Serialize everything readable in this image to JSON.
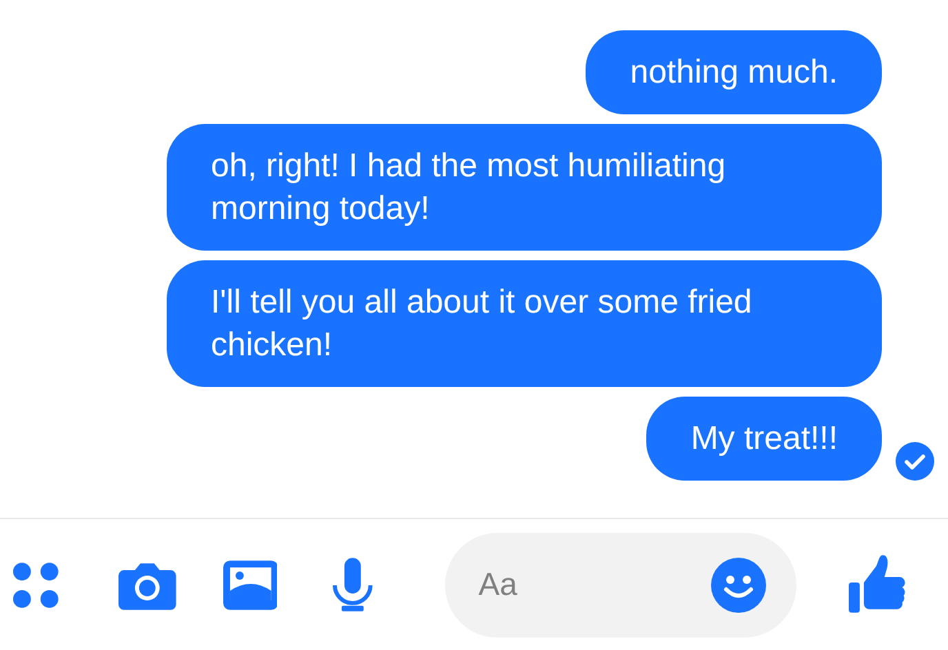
{
  "messages": [
    {
      "text": "nothing much.",
      "delivered": false
    },
    {
      "text": "oh, right! I had the most humiliating morning today!",
      "delivered": false
    },
    {
      "text": "I'll tell you all about it over some fried chicken!",
      "delivered": false
    },
    {
      "text": "My treat!!!",
      "delivered": true
    }
  ],
  "composer": {
    "placeholder": "Aa"
  }
}
